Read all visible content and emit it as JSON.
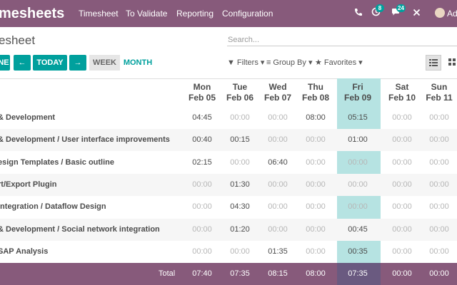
{
  "navbar": {
    "brand": "mesheets",
    "menu": [
      "Timesheet",
      "To Validate",
      "Reporting",
      "Configuration"
    ],
    "icons": [
      "phone-icon",
      "activity-icon",
      "chat-icon",
      "close-icon"
    ],
    "activity_badge": "8",
    "chat_badge": "24",
    "user": "Ad"
  },
  "control": {
    "breadcrumb": "esheet",
    "search_placeholder": "Search...",
    "buttons": {
      "partial": "NE",
      "prev": "←",
      "today": "TODAY",
      "next": "→",
      "week": "WEEK",
      "month": "MONTH"
    },
    "filters": "Filters",
    "group_by": "Group By",
    "favorites": "Favorites"
  },
  "days": [
    {
      "dow": "Mon",
      "date": "Feb 05"
    },
    {
      "dow": "Tue",
      "date": "Feb 06"
    },
    {
      "dow": "Wed",
      "date": "Feb 07"
    },
    {
      "dow": "Thu",
      "date": "Feb 08"
    },
    {
      "dow": "Fri",
      "date": "Feb 09"
    },
    {
      "dow": "Sat",
      "date": "Feb 10"
    },
    {
      "dow": "Sun",
      "date": "Feb 11"
    }
  ],
  "rows": [
    {
      "label": "& Development",
      "values": [
        "04:45",
        "00:00",
        "00:00",
        "08:00",
        "05:15",
        "00:00",
        "00:00"
      ]
    },
    {
      "label": "& Development / User interface improvements",
      "values": [
        "00:40",
        "00:15",
        "00:00",
        "00:00",
        "01:00",
        "00:00",
        "00:00"
      ]
    },
    {
      "label": "esign Templates / Basic outline",
      "values": [
        "02:15",
        "00:00",
        "06:40",
        "00:00",
        "00:00",
        "00:00",
        "00:00"
      ]
    },
    {
      "label": "rt/Export Plugin",
      "values": [
        "00:00",
        "01:30",
        "00:00",
        "00:00",
        "00:00",
        "00:00",
        "00:00"
      ]
    },
    {
      "label": "Integration / Dataflow Design",
      "values": [
        "00:00",
        "04:30",
        "00:00",
        "00:00",
        "00:00",
        "00:00",
        "00:00"
      ]
    },
    {
      "label": "& Development / Social network integration",
      "values": [
        "00:00",
        "01:20",
        "00:00",
        "00:00",
        "00:45",
        "00:00",
        "00:00"
      ]
    },
    {
      "label": "SAP Analysis",
      "values": [
        "00:00",
        "00:00",
        "01:35",
        "00:00",
        "00:35",
        "00:00",
        "00:00"
      ]
    }
  ],
  "totals": {
    "label": "Total",
    "values": [
      "07:40",
      "07:35",
      "08:15",
      "08:00",
      "07:35",
      "00:00",
      "00:00"
    ]
  }
}
